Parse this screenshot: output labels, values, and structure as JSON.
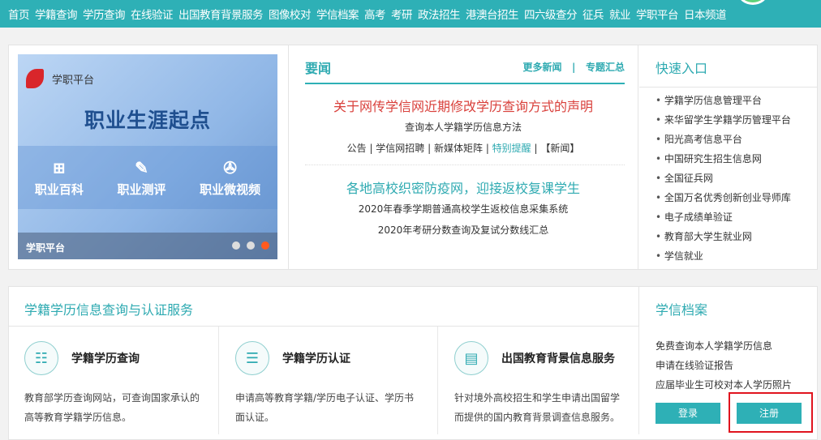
{
  "nav": [
    "首页",
    "学籍查询",
    "学历查询",
    "在线验证",
    "出国教育背景服务",
    "图像校对",
    "学信档案",
    "高考",
    "考研",
    "政法招生",
    "港澳台招生",
    "四六级查分",
    "征兵",
    "就业",
    "学职平台",
    "日本频道"
  ],
  "banner": {
    "logo": "学职平台",
    "slogan": "职业生涯起点",
    "items": [
      "职业百科",
      "职业测评",
      "职业微视频"
    ],
    "caption": "学职平台",
    "slides": 3,
    "active_slide": 3
  },
  "news": {
    "title": "要闻",
    "more": "更多新闻",
    "sep": "|",
    "topics": "专题汇总",
    "headline1": "关于网传学信网近期修改学历查询方式的声明",
    "sub1": "查询本人学籍学历信息方法",
    "links": [
      "公告",
      "学信网招聘",
      "新媒体矩阵",
      "特别提醒",
      "【新闻】"
    ],
    "headline2": "各地高校织密防疫网，迎接返校复课学生",
    "sub2": "2020年春季学期普通高校学生返校信息采集系统",
    "sub3": "2020年考研分数查询及复试分数线汇总"
  },
  "quick": {
    "title": "快速入口",
    "items": [
      "学籍学历信息管理平台",
      "来华留学生学籍学历管理平台",
      "阳光高考信息平台",
      "中国研究生招生信息网",
      "全国征兵网",
      "全国万名优秀创新创业导师库",
      "电子成绩单验证",
      "教育部大学生就业网",
      "学信就业"
    ]
  },
  "services": {
    "title": "学籍学历信息查询与认证服务",
    "cards": [
      {
        "title": "学籍学历查询",
        "desc": "教育部学历查询网站，可查询国家承认的高等教育学籍学历信息。"
      },
      {
        "title": "学籍学历认证",
        "desc": "申请高等教育学籍/学历电子认证、学历书面认证。"
      },
      {
        "title": "出国教育背景信息服务",
        "desc": "针对境外高校招生和学生申请出国留学而提供的国内教育背景调查信息服务。"
      }
    ]
  },
  "archive": {
    "title": "学信档案",
    "items": [
      "免费查询本人学籍学历信息",
      "申请在线验证报告",
      "应届毕业生可校对本人学历照片"
    ],
    "login": "登录",
    "register": "注册"
  }
}
